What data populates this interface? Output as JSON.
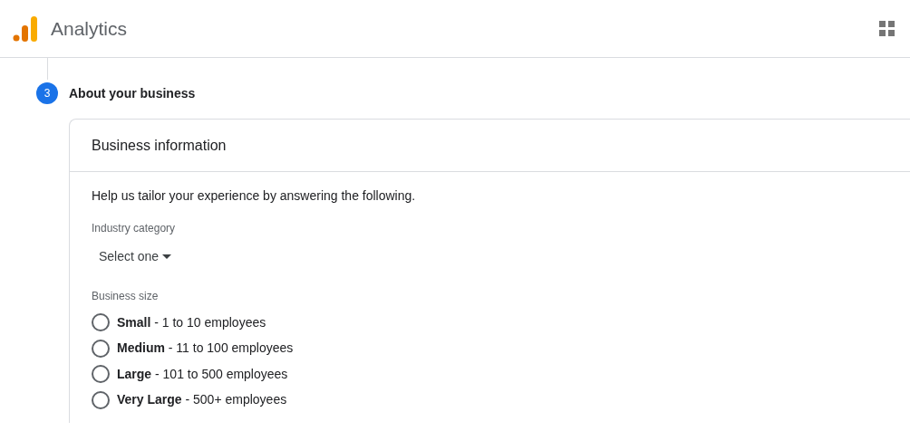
{
  "app_bar": {
    "title": "Analytics"
  },
  "step": {
    "number": "3",
    "title": "About your business"
  },
  "card": {
    "title": "Business information",
    "intro": "Help us tailor your experience by answering the following.",
    "industry": {
      "label": "Industry category",
      "value": "Select one"
    },
    "size": {
      "label": "Business size",
      "options": [
        {
          "label": "**Small** - 1 to 10 employees",
          "selected": false
        },
        {
          "label": "**Medium** - 11 to 100 employees",
          "selected": false
        },
        {
          "label": "**Large** - 101 to 500 employees",
          "selected": false
        },
        {
          "label": "**Very Large** - 500+ employees",
          "selected": false
        }
      ]
    }
  }
}
